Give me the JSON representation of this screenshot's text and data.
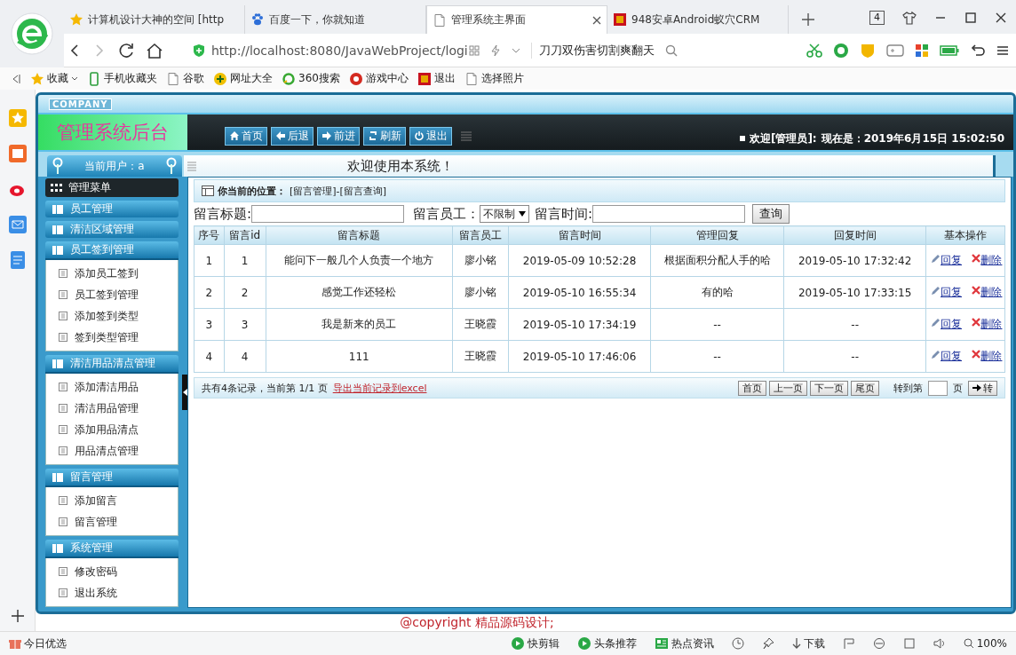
{
  "browser": {
    "tabs": [
      {
        "kind": "star",
        "title": "计算机设计大神的空间 [http",
        "selected": false
      },
      {
        "kind": "paw",
        "title": "百度一下，你就知道",
        "selected": false
      },
      {
        "kind": "page",
        "title": "管理系统主界面",
        "selected": true
      },
      {
        "kind": "square",
        "title": "948安卓Android蚁穴CRM",
        "selected": false
      }
    ],
    "tab_count": "4",
    "url": "http://localhost:8080/JavaWebProject/logi",
    "search_hint": "刀刀双伤害切割爽翻天",
    "bookmarks": [
      {
        "kind": "star",
        "label": "收藏"
      },
      {
        "kind": "phone",
        "label": "手机收藏夹"
      },
      {
        "kind": "page",
        "label": "谷歌"
      },
      {
        "kind": "plus",
        "label": "网址大全"
      },
      {
        "kind": "ring",
        "label": "360搜索"
      },
      {
        "kind": "game",
        "label": "游戏中心"
      },
      {
        "kind": "square",
        "label": "退出"
      },
      {
        "kind": "page",
        "label": "选择照片"
      }
    ]
  },
  "app": {
    "company": "COMPANY",
    "title": "管理系统后台",
    "nav": [
      {
        "kind": "home",
        "label": "首页"
      },
      {
        "kind": "back",
        "label": "后退"
      },
      {
        "kind": "forward",
        "label": "前进"
      },
      {
        "kind": "refresh",
        "label": "刷新"
      },
      {
        "kind": "power",
        "label": "退出"
      }
    ],
    "welcome": "欢迎[管理员]:",
    "clock": "现在是：2019年6月15日 15:02:50",
    "current_user": "当前用户：a",
    "banner": "欢迎使用本系统！",
    "menu_title": "管理菜单",
    "menu": [
      {
        "label": "员工管理",
        "expanded": false
      },
      {
        "label": "清洁区域管理",
        "expanded": false
      },
      {
        "label": "员工签到管理",
        "expanded": true,
        "children": [
          "添加员工签到",
          "员工签到管理",
          "添加签到类型",
          "签到类型管理"
        ]
      },
      {
        "label": "清洁用品清点管理",
        "expanded": true,
        "children": [
          "添加清洁用品",
          "清洁用品管理",
          "添加用品清点",
          "用品清点管理"
        ]
      },
      {
        "label": "留言管理",
        "expanded": true,
        "children": [
          "添加留言",
          "留言管理"
        ]
      },
      {
        "label": "系统管理",
        "expanded": true,
        "children": [
          "修改密码",
          "退出系统"
        ]
      }
    ],
    "breadcrumb_label": "你当前的位置：",
    "breadcrumb": "[留言管理]-[留言查询]",
    "search": {
      "title_label": "留言标题:",
      "employee_label": "留言员工：",
      "employee_value": "不限制",
      "time_label": "留言时间:",
      "button": "查询"
    },
    "table": {
      "columns": [
        "序号",
        "留言id",
        "留言标题",
        "留言员工",
        "留言时间",
        "管理回复",
        "回复时间",
        "基本操作"
      ],
      "rows": [
        {
          "seq": "1",
          "id": "1",
          "title": "能问下一般几个人负责一个地方",
          "employee": "廖小铭",
          "time": "2019-05-09 10:52:28",
          "reply": "根据面积分配人手的哈",
          "reply_time": "2019-05-10 17:32:42",
          "actions": [
            "回复",
            "删除"
          ]
        },
        {
          "seq": "2",
          "id": "2",
          "title": "感觉工作还轻松",
          "employee": "廖小铭",
          "time": "2019-05-10 16:55:34",
          "reply": "有的哈",
          "reply_time": "2019-05-10 17:33:15",
          "actions": [
            "回复",
            "删除"
          ]
        },
        {
          "seq": "3",
          "id": "3",
          "title": "我是新来的员工",
          "employee": "王晓霞",
          "time": "2019-05-10 17:34:19",
          "reply": "--",
          "reply_time": "--",
          "actions": [
            "回复",
            "删除"
          ]
        },
        {
          "seq": "4",
          "id": "4",
          "title": "111",
          "employee": "王晓霞",
          "time": "2019-05-10 17:46:06",
          "reply": "--",
          "reply_time": "--",
          "actions": [
            "回复",
            "删除"
          ]
        }
      ]
    },
    "pager": {
      "summary": "共有4条记录，当前第 1/1 页",
      "export": "导出当前记录到excel",
      "buttons": [
        "首页",
        "上一页",
        "下一页",
        "尾页"
      ],
      "goto_label": "转到第",
      "page_unit": "页",
      "go": "转"
    },
    "copyright": "@copyright 精品源码设计;"
  },
  "status_bar": {
    "left": "今日优选",
    "items": [
      {
        "kind": "play",
        "label": "快剪辑"
      },
      {
        "kind": "play",
        "label": "头条推荐"
      },
      {
        "kind": "news",
        "label": "热点资讯"
      }
    ],
    "download": "下载",
    "zoom": "100%"
  }
}
